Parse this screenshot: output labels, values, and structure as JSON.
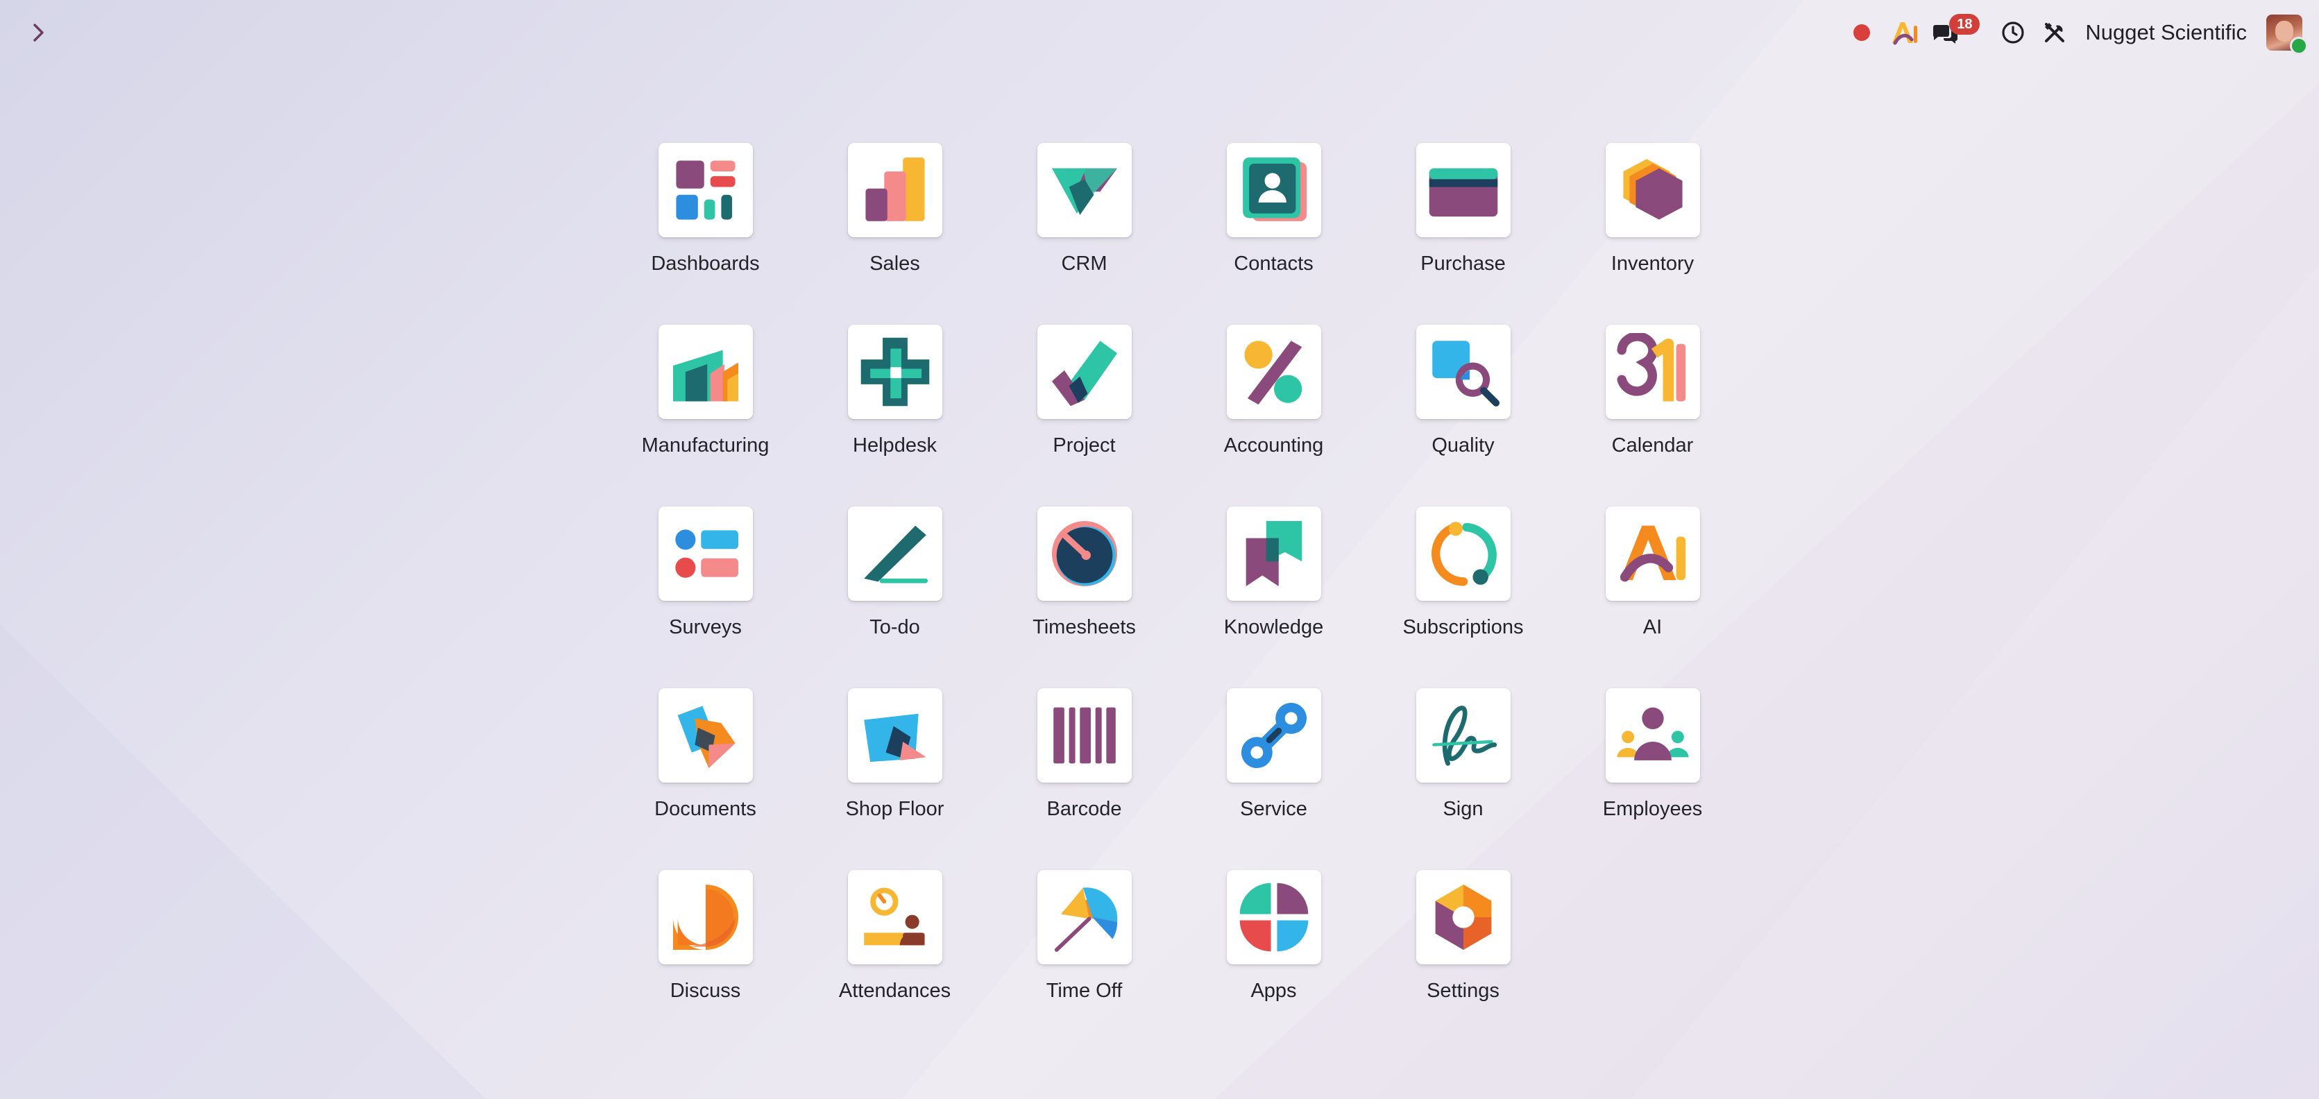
{
  "navbar": {
    "company_name": "Nugget Scientific",
    "message_count": "18"
  },
  "apps": [
    {
      "label": "Dashboards",
      "icon": "dashboards-icon"
    },
    {
      "label": "Sales",
      "icon": "sales-icon"
    },
    {
      "label": "CRM",
      "icon": "crm-icon"
    },
    {
      "label": "Contacts",
      "icon": "contacts-icon"
    },
    {
      "label": "Purchase",
      "icon": "purchase-icon"
    },
    {
      "label": "Inventory",
      "icon": "inventory-icon"
    },
    {
      "label": "Manufacturing",
      "icon": "manufacturing-icon"
    },
    {
      "label": "Helpdesk",
      "icon": "helpdesk-icon"
    },
    {
      "label": "Project",
      "icon": "project-icon"
    },
    {
      "label": "Accounting",
      "icon": "accounting-icon"
    },
    {
      "label": "Quality",
      "icon": "quality-icon"
    },
    {
      "label": "Calendar",
      "icon": "calendar-icon"
    },
    {
      "label": "Surveys",
      "icon": "surveys-icon"
    },
    {
      "label": "To-do",
      "icon": "to-do-icon"
    },
    {
      "label": "Timesheets",
      "icon": "timesheets-icon"
    },
    {
      "label": "Knowledge",
      "icon": "knowledge-icon"
    },
    {
      "label": "Subscriptions",
      "icon": "subscriptions-icon"
    },
    {
      "label": "AI",
      "icon": "ai-icon"
    },
    {
      "label": "Documents",
      "icon": "documents-icon"
    },
    {
      "label": "Shop Floor",
      "icon": "shop-floor-icon"
    },
    {
      "label": "Barcode",
      "icon": "barcode-icon"
    },
    {
      "label": "Service",
      "icon": "service-icon"
    },
    {
      "label": "Sign",
      "icon": "sign-icon"
    },
    {
      "label": "Employees",
      "icon": "employees-icon"
    },
    {
      "label": "Discuss",
      "icon": "discuss-icon"
    },
    {
      "label": "Attendances",
      "icon": "attendances-icon"
    },
    {
      "label": "Time Off",
      "icon": "time-off-icon"
    },
    {
      "label": "Apps",
      "icon": "apps-icon"
    },
    {
      "label": "Settings",
      "icon": "settings-icon"
    }
  ],
  "colors": {
    "purple": "#8b4a7c",
    "teal": "#2ec4a6",
    "dark_teal": "#1d6b6e",
    "blue": "#2d8ee0",
    "light_blue": "#33b5ea",
    "orange": "#f58a1f",
    "yellow": "#f7b733",
    "pink": "#f48a8a",
    "red": "#e84b4b",
    "notification_red": "#d23f3a"
  }
}
